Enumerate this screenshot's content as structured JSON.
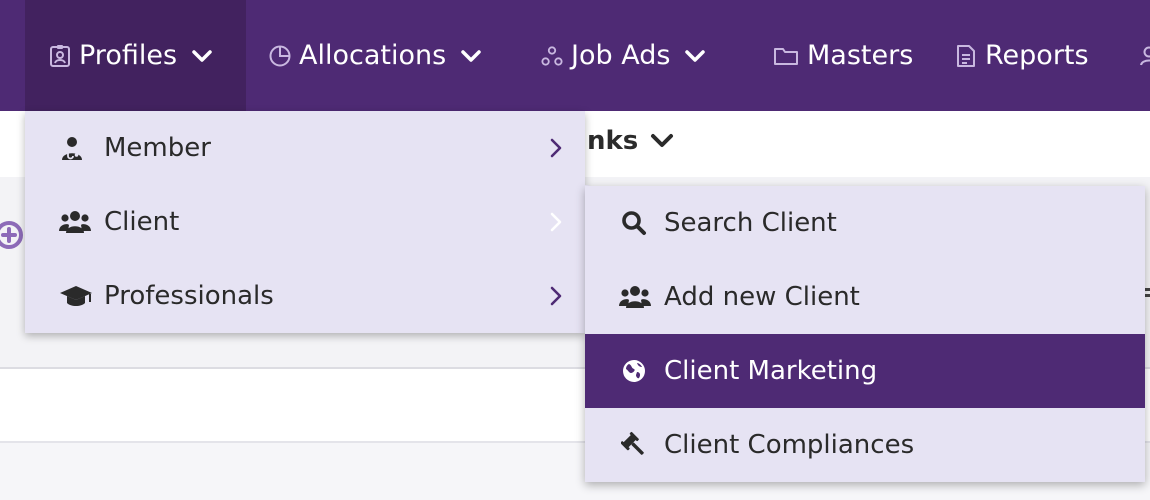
{
  "colors": {
    "nav_bg": "#4e2a74",
    "nav_active_bg": "#42225f",
    "menu_bg": "#e6e3f3",
    "menu_active_bg": "#4e2a74",
    "menu_text": "#2a2a2a"
  },
  "nav": {
    "items": [
      {
        "label": "Profiles",
        "icon": "id-badge-icon",
        "has_dropdown": true,
        "active": true
      },
      {
        "label": "Allocations",
        "icon": "pie-chart-icon",
        "has_dropdown": true
      },
      {
        "label": "Job Ads",
        "icon": "nodes-icon",
        "has_dropdown": true
      },
      {
        "label": "Masters",
        "icon": "folder-icon",
        "has_dropdown": false
      },
      {
        "label": "Reports",
        "icon": "document-icon",
        "has_dropdown": false
      }
    ]
  },
  "background": {
    "section_header_partial": "nks"
  },
  "profiles_menu": {
    "items": [
      {
        "label": "Member",
        "icon": "doctor-icon"
      },
      {
        "label": "Client",
        "icon": "users-icon"
      },
      {
        "label": "Professionals",
        "icon": "graduation-cap-icon"
      }
    ]
  },
  "client_submenu": {
    "items": [
      {
        "label": "Search Client",
        "icon": "search-icon"
      },
      {
        "label": "Add new Client",
        "icon": "users-icon"
      },
      {
        "label": "Client Marketing",
        "icon": "globe-icon",
        "active": true
      },
      {
        "label": "Client Compliances",
        "icon": "gavel-icon"
      }
    ]
  }
}
